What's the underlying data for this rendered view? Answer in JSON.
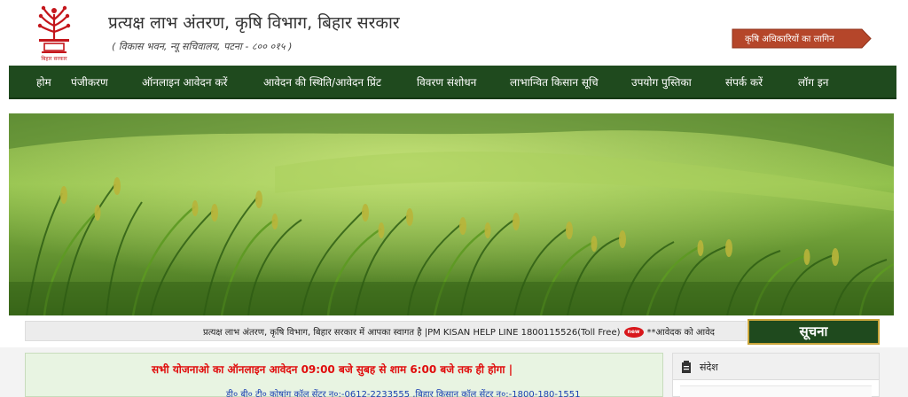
{
  "header": {
    "logo_caption": "बिहार सरकार",
    "title": "प्रत्यक्ष लाभ अंतरण, कृषि विभाग, बिहार सरकार",
    "address": "( विकास भवन, न्यू सचिवालय, पटना - ८०० ०१५ )",
    "officer_button": "कृषि अधिकारियों का लागिन"
  },
  "nav": {
    "items": [
      {
        "label": "होम"
      },
      {
        "label": "पंजीकरण"
      },
      {
        "label": "ऑनलाइन आवेदन करें"
      },
      {
        "label": "आवेदन की स्थिति/आवेदन प्रिंट"
      },
      {
        "label": "विवरण संशोधन"
      },
      {
        "label": "लाभान्वित किसान सूचि"
      },
      {
        "label": "उपयोग पुस्तिका"
      },
      {
        "label": "संपर्क करें"
      },
      {
        "label": "लॉग इन"
      }
    ]
  },
  "ticker": {
    "text": "प्रत्यक्ष लाभ अंतरण, कृषि विभाग, बिहार सरकार में आपका स्वागत है |PM KISAN HELP LINE 1800115526(Toll Free)",
    "badge": "new",
    "text_after": "**आवेदक को आवेद"
  },
  "notice_button": "सूचना",
  "announcement": {
    "headline": "सभी योजनाओ का ऑनलाइन आवेदन 09:00 बजे सुबह से शाम 6:00 बजे तक ही होगा |",
    "helpline": "डी० बी० टी० कोषांग कॉल सेंटर न०:-0612-2233555 ,बिहार किसान कॉल सेंटर न०:-1800-180-1551"
  },
  "message_panel": {
    "title": "संदेश"
  },
  "colors": {
    "nav_bg": "#1f4a1e",
    "officer_button_bg": "#b5462a",
    "announcement_red": "#e00d0d",
    "helpline_blue": "#1a3fb0",
    "notice_border": "#c9a43a"
  }
}
